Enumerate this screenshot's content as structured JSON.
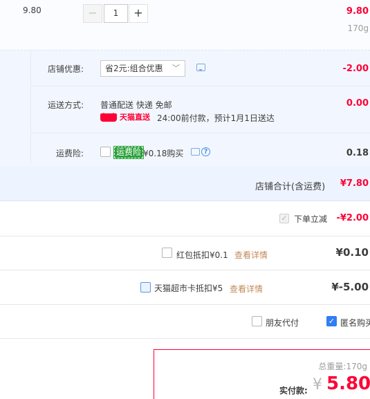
{
  "item": {
    "unit_price": "9.80",
    "quantity": "1",
    "minus": "−",
    "plus": "+",
    "total": "9.80",
    "weight": "170g"
  },
  "shop": {
    "promo_label": "店铺优惠:",
    "promo_select": "省2元:组合优惠",
    "promo_amount": "-2.00",
    "shipping_label": "运送方式:",
    "shipping_method": "普通配送 快递 免邮",
    "shipping_brand": "天猫直送",
    "shipping_note": "24:00前付款，预计1月1日送达",
    "shipping_amount": "0.00",
    "insurance_label": "运费险:",
    "insurance_tag": "运费险",
    "insurance_price": "¥0.18购买",
    "insurance_amount": "0.18",
    "total_label": "店铺合计(含运费)",
    "total_amount": "¥7.80"
  },
  "discounts": {
    "instant_label": "下单立减",
    "instant_amount": "-¥2.00",
    "redpacket_label": "红包抵扣¥0.1",
    "redpacket_link": "查看详情",
    "redpacket_amount": "¥0.10",
    "supercard_label": "天猫超市卡抵扣¥5",
    "supercard_link": "查看详情",
    "supercard_amount": "¥-5.00",
    "friend_pay_label": "朋友代付",
    "anonymous_label": "匿名购买"
  },
  "payment": {
    "weight_label": "总重量:",
    "weight_value": "170g",
    "label": "实付款:",
    "currency": "¥",
    "amount": "5.80"
  },
  "colors": {
    "price_red": "#ff0036",
    "accent_blue": "#2f7ef2",
    "insurance_green": "#2aa13a"
  }
}
